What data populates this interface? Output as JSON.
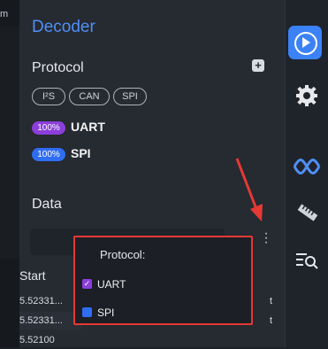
{
  "left_strip": {
    "tick_label": "m"
  },
  "decoder": {
    "title": "Decoder"
  },
  "protocol_section": {
    "label": "Protocol",
    "chips": [
      "I²S",
      "CAN",
      "SPI"
    ],
    "active": [
      {
        "badge": "100%",
        "name": "UART",
        "color": "#8b3fd9"
      },
      {
        "badge": "100%",
        "name": "SPI",
        "color": "#2f6df2"
      }
    ]
  },
  "data_section": {
    "label": "Data"
  },
  "table": {
    "header": "Start",
    "rows": [
      "5.52331...",
      "5.52331...",
      "5.52100"
    ],
    "row_tails": [
      "t",
      "t"
    ]
  },
  "popup": {
    "title": "Protocol:",
    "options": [
      {
        "label": "UART",
        "checked": true,
        "color": "#8b3fd9"
      },
      {
        "label": "SPI",
        "checked": false,
        "color": "#2f6df2"
      }
    ]
  },
  "rail": {
    "icons": [
      "play-icon",
      "gear-icon",
      "waveform-icon",
      "ruler-icon",
      "search-list-icon"
    ]
  },
  "colors": {
    "accent": "#3b82f6",
    "highlight": "#e53935"
  }
}
